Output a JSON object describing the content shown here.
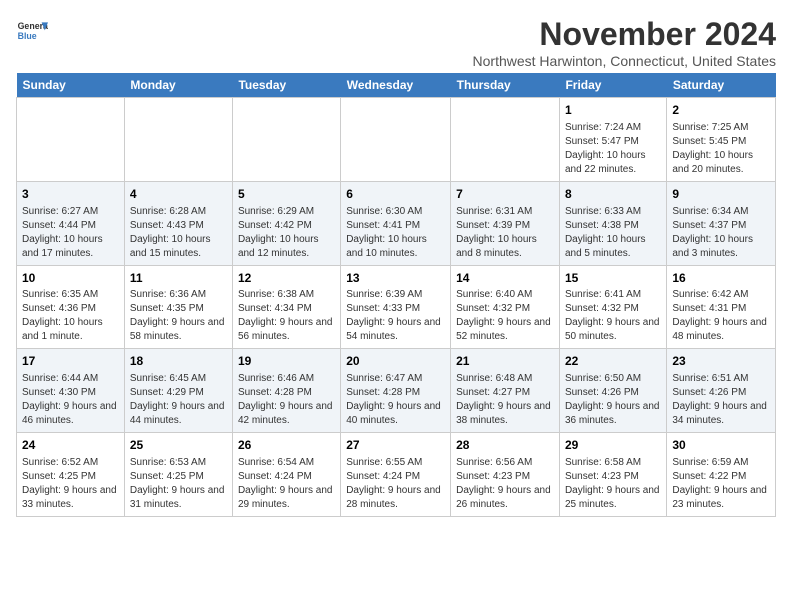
{
  "logo": {
    "line1": "General",
    "line2": "Blue"
  },
  "title": "November 2024",
  "subtitle": "Northwest Harwinton, Connecticut, United States",
  "days_of_week": [
    "Sunday",
    "Monday",
    "Tuesday",
    "Wednesday",
    "Thursday",
    "Friday",
    "Saturday"
  ],
  "weeks": [
    [
      {
        "day": "",
        "info": ""
      },
      {
        "day": "",
        "info": ""
      },
      {
        "day": "",
        "info": ""
      },
      {
        "day": "",
        "info": ""
      },
      {
        "day": "",
        "info": ""
      },
      {
        "day": "1",
        "info": "Sunrise: 7:24 AM\nSunset: 5:47 PM\nDaylight: 10 hours and 22 minutes."
      },
      {
        "day": "2",
        "info": "Sunrise: 7:25 AM\nSunset: 5:45 PM\nDaylight: 10 hours and 20 minutes."
      }
    ],
    [
      {
        "day": "3",
        "info": "Sunrise: 6:27 AM\nSunset: 4:44 PM\nDaylight: 10 hours and 17 minutes."
      },
      {
        "day": "4",
        "info": "Sunrise: 6:28 AM\nSunset: 4:43 PM\nDaylight: 10 hours and 15 minutes."
      },
      {
        "day": "5",
        "info": "Sunrise: 6:29 AM\nSunset: 4:42 PM\nDaylight: 10 hours and 12 minutes."
      },
      {
        "day": "6",
        "info": "Sunrise: 6:30 AM\nSunset: 4:41 PM\nDaylight: 10 hours and 10 minutes."
      },
      {
        "day": "7",
        "info": "Sunrise: 6:31 AM\nSunset: 4:39 PM\nDaylight: 10 hours and 8 minutes."
      },
      {
        "day": "8",
        "info": "Sunrise: 6:33 AM\nSunset: 4:38 PM\nDaylight: 10 hours and 5 minutes."
      },
      {
        "day": "9",
        "info": "Sunrise: 6:34 AM\nSunset: 4:37 PM\nDaylight: 10 hours and 3 minutes."
      }
    ],
    [
      {
        "day": "10",
        "info": "Sunrise: 6:35 AM\nSunset: 4:36 PM\nDaylight: 10 hours and 1 minute."
      },
      {
        "day": "11",
        "info": "Sunrise: 6:36 AM\nSunset: 4:35 PM\nDaylight: 9 hours and 58 minutes."
      },
      {
        "day": "12",
        "info": "Sunrise: 6:38 AM\nSunset: 4:34 PM\nDaylight: 9 hours and 56 minutes."
      },
      {
        "day": "13",
        "info": "Sunrise: 6:39 AM\nSunset: 4:33 PM\nDaylight: 9 hours and 54 minutes."
      },
      {
        "day": "14",
        "info": "Sunrise: 6:40 AM\nSunset: 4:32 PM\nDaylight: 9 hours and 52 minutes."
      },
      {
        "day": "15",
        "info": "Sunrise: 6:41 AM\nSunset: 4:32 PM\nDaylight: 9 hours and 50 minutes."
      },
      {
        "day": "16",
        "info": "Sunrise: 6:42 AM\nSunset: 4:31 PM\nDaylight: 9 hours and 48 minutes."
      }
    ],
    [
      {
        "day": "17",
        "info": "Sunrise: 6:44 AM\nSunset: 4:30 PM\nDaylight: 9 hours and 46 minutes."
      },
      {
        "day": "18",
        "info": "Sunrise: 6:45 AM\nSunset: 4:29 PM\nDaylight: 9 hours and 44 minutes."
      },
      {
        "day": "19",
        "info": "Sunrise: 6:46 AM\nSunset: 4:28 PM\nDaylight: 9 hours and 42 minutes."
      },
      {
        "day": "20",
        "info": "Sunrise: 6:47 AM\nSunset: 4:28 PM\nDaylight: 9 hours and 40 minutes."
      },
      {
        "day": "21",
        "info": "Sunrise: 6:48 AM\nSunset: 4:27 PM\nDaylight: 9 hours and 38 minutes."
      },
      {
        "day": "22",
        "info": "Sunrise: 6:50 AM\nSunset: 4:26 PM\nDaylight: 9 hours and 36 minutes."
      },
      {
        "day": "23",
        "info": "Sunrise: 6:51 AM\nSunset: 4:26 PM\nDaylight: 9 hours and 34 minutes."
      }
    ],
    [
      {
        "day": "24",
        "info": "Sunrise: 6:52 AM\nSunset: 4:25 PM\nDaylight: 9 hours and 33 minutes."
      },
      {
        "day": "25",
        "info": "Sunrise: 6:53 AM\nSunset: 4:25 PM\nDaylight: 9 hours and 31 minutes."
      },
      {
        "day": "26",
        "info": "Sunrise: 6:54 AM\nSunset: 4:24 PM\nDaylight: 9 hours and 29 minutes."
      },
      {
        "day": "27",
        "info": "Sunrise: 6:55 AM\nSunset: 4:24 PM\nDaylight: 9 hours and 28 minutes."
      },
      {
        "day": "28",
        "info": "Sunrise: 6:56 AM\nSunset: 4:23 PM\nDaylight: 9 hours and 26 minutes."
      },
      {
        "day": "29",
        "info": "Sunrise: 6:58 AM\nSunset: 4:23 PM\nDaylight: 9 hours and 25 minutes."
      },
      {
        "day": "30",
        "info": "Sunrise: 6:59 AM\nSunset: 4:22 PM\nDaylight: 9 hours and 23 minutes."
      }
    ]
  ]
}
